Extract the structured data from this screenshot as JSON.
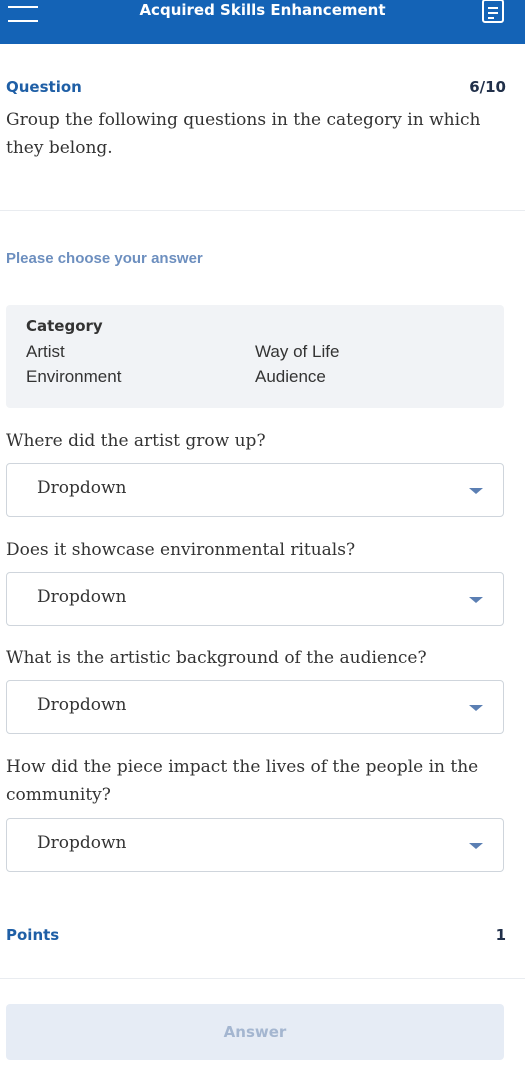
{
  "header": {
    "title": "Acquired Skills Enhancement",
    "menu_icon": "hamburger-menu-icon",
    "notes_icon": "notes-list-icon"
  },
  "question": {
    "label": "Question",
    "counter": "6/10",
    "text": "Group the following questions in the category in which they belong."
  },
  "choose_prompt": "Please choose your answer",
  "category_box": {
    "title": "Category",
    "items": [
      "Artist",
      "Way of Life",
      "Environment",
      "Audience"
    ]
  },
  "items": [
    {
      "question": "Where did the artist grow up?",
      "selected": "Dropdown"
    },
    {
      "question": "Does it showcase environmental rituals?",
      "selected": "Dropdown"
    },
    {
      "question": "What is the artistic background of the audience?",
      "selected": "Dropdown"
    },
    {
      "question": "How did the piece impact the lives of the people in the community?",
      "selected": "Dropdown"
    }
  ],
  "points": {
    "label": "Points",
    "value": "1"
  },
  "answer_button": "Answer",
  "colors": {
    "header_bg": "#1463b6",
    "accent_text": "#1f5fa6",
    "prompt_text": "#6d8fbf",
    "answer_button_bg": "#e6ecf5"
  }
}
